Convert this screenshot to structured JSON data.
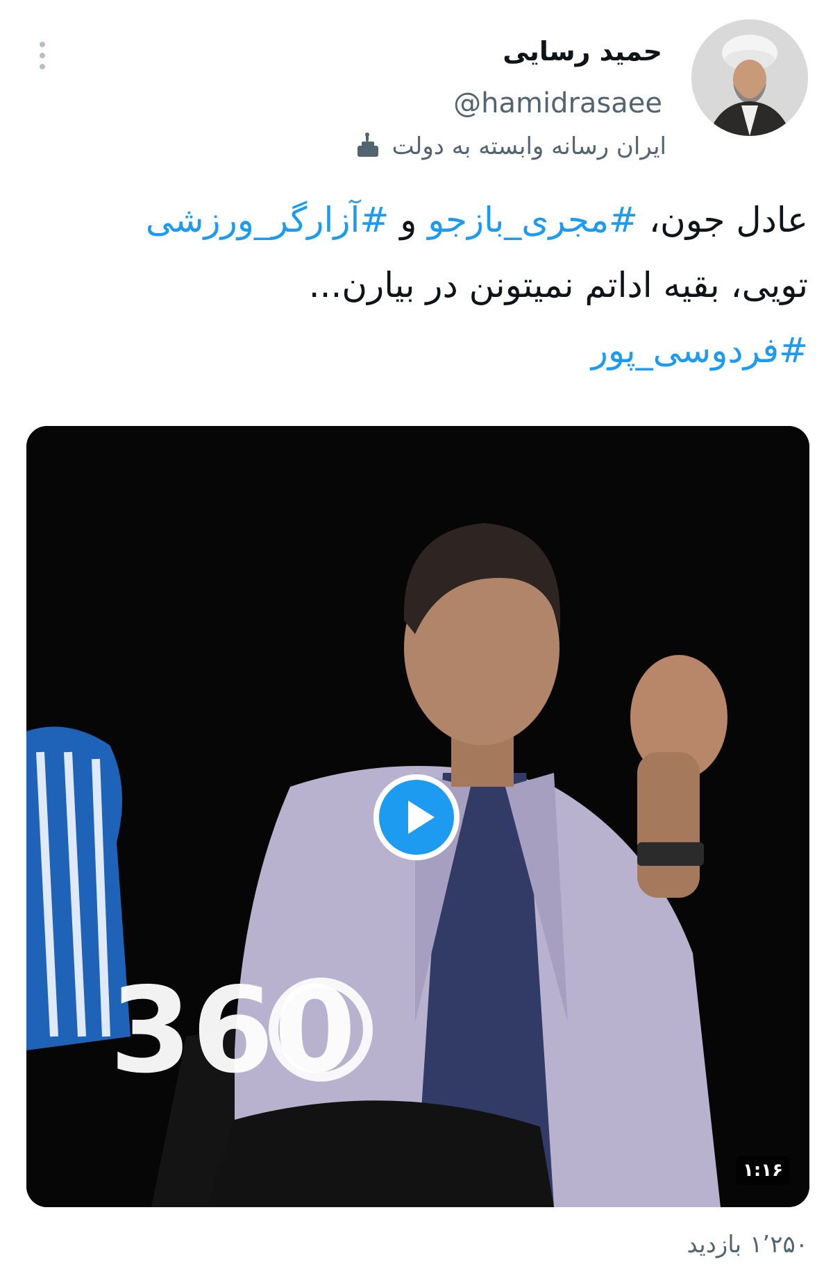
{
  "author": {
    "display_name": "حمید رسایی",
    "handle": "@hamidrasaee",
    "affiliation_label": "ایران رسانه وابسته به دولت",
    "affiliation_icon": "podium-icon"
  },
  "menu": {
    "icon": "more-vertical-icon"
  },
  "tweet": {
    "line1_part1": "عادل جون، ",
    "line1_hashtag1": "#مجری_بازجو",
    "line1_part2": " و ",
    "line1_hashtag2": "#آزارگر_ورزشی",
    "line2": "تویی، بقیه اداتم نمیتونن در بیارن...",
    "line3_hashtag": "#فردوسی_پور"
  },
  "media": {
    "type": "video",
    "duration": "۱:۱۶",
    "play_icon": "play-icon",
    "watermark": "360"
  },
  "stats": {
    "views_count": "۱٬۲۵۰",
    "views_label": "بازدید"
  },
  "colors": {
    "accent": "#1d9bf0",
    "secondary_text": "#536471",
    "primary_text": "#0f1419"
  }
}
